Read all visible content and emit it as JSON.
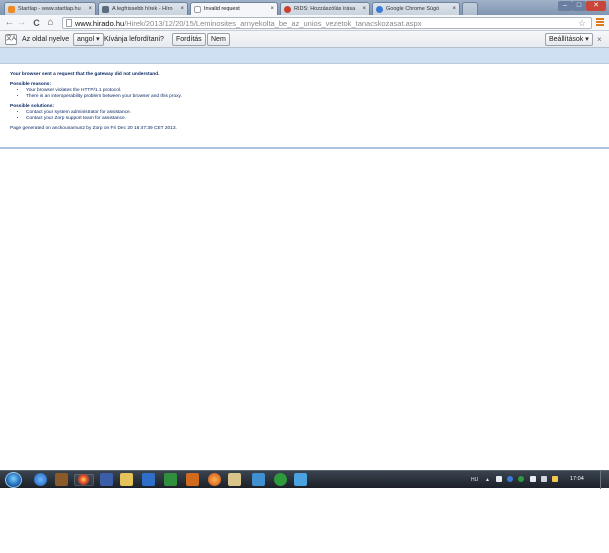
{
  "tabs": [
    {
      "title": "Startlap - www.startlap.hu",
      "active": false,
      "favicon_color": "#f08a24"
    },
    {
      "title": "A legfrissebb hírek - Híro",
      "active": false,
      "favicon_color": "#5a6b80"
    },
    {
      "title": "Invalid request",
      "active": true,
      "favicon_color": "#cfd6de"
    },
    {
      "title": "RIDS: Hozzászólás írása",
      "active": false,
      "favicon_color": "#c8402a"
    },
    {
      "title": "Google Chrome Súgó",
      "active": false,
      "favicon_color": "#3b7bd8"
    }
  ],
  "window_controls": {
    "minimize": "–",
    "maximize": "□",
    "close": "✕"
  },
  "nav": {
    "back": "←",
    "forward": "→",
    "reload": "C",
    "home": "⌂"
  },
  "address": {
    "host": "www.hirado.hu",
    "path": "/Hirek/2013/12/20/15/Leminosites_arnyekolta_be_az_unios_vezetok_tanacskozasat.aspx"
  },
  "icons": {
    "bookmark_star": "star-icon",
    "menu": "menu-icon",
    "translate": "translate-icon"
  },
  "translate_bar": {
    "lang_prompt": "Az oldal nyelve",
    "language_value": "angol",
    "question": "Kívánja lefordítani?",
    "translate_button": "Fordítás",
    "no_button": "Nem",
    "settings_button": "Beállítások",
    "close": "×"
  },
  "page": {
    "headline": "Your browser sent a request that the gateway did not understand.",
    "reasons_heading": "Possible reasons:",
    "reasons": [
      "Your browser violates the HTTP/1.1 protocol.",
      "There is an interoperability problem between your browser and this proxy."
    ],
    "solutions_heading": "Possible solutions:",
    "solutions": [
      "Contact your system administrator for assistance.",
      "Contact your Zorp support team for assistance."
    ],
    "footer": "Page generated on anckounamun2 by Zorp on Fri Dec 20 16:47:39 CET 2013."
  },
  "taskbar": {
    "tray_lang": "HU",
    "clock": "17:04"
  },
  "colors": {
    "accent_blue": "#cfe0f3",
    "text_navy": "#0b2a66",
    "menu_orange": "#e07a1a",
    "close_red": "#c9453a"
  }
}
